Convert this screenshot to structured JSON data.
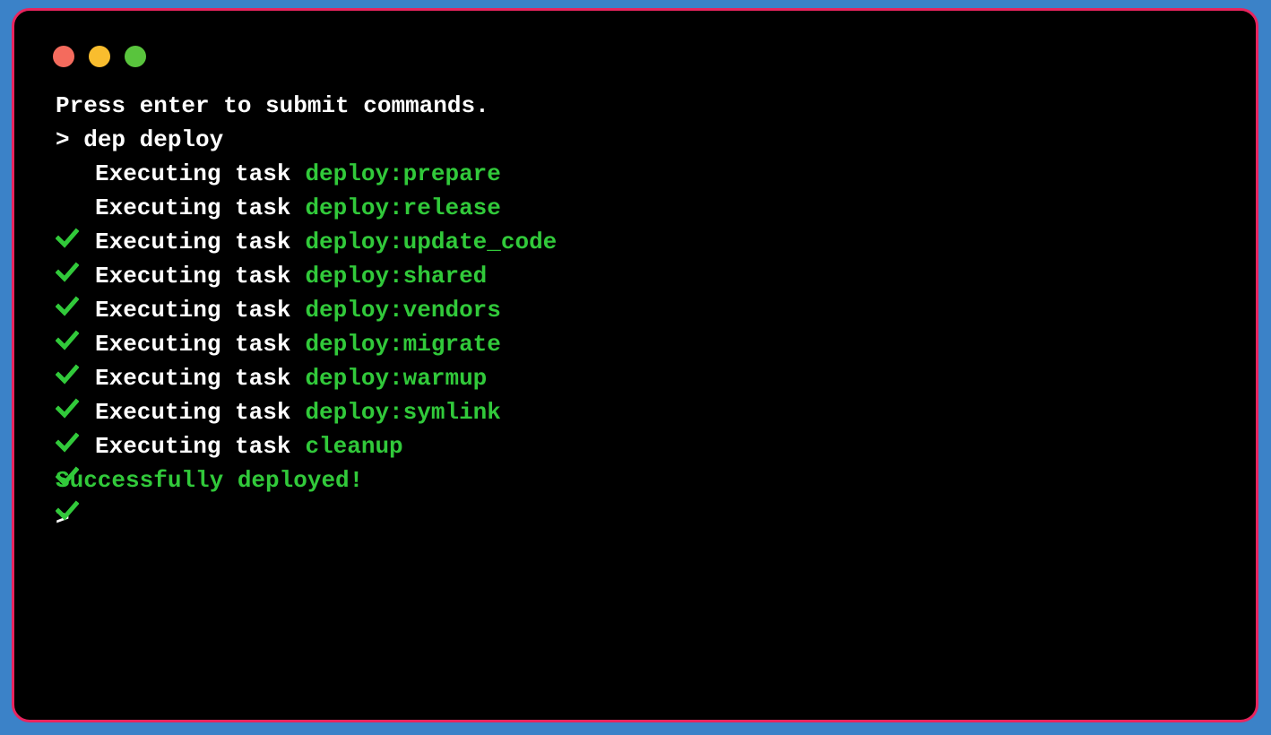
{
  "colors": {
    "background": "#3b82c8",
    "window_border": "#e8245e",
    "terminal_bg": "#000000",
    "text": "#ffffff",
    "accent_green": "#31c93a",
    "light_close": "#f46b5d",
    "light_minimize": "#f9bd2e",
    "light_maximize": "#59c43d"
  },
  "icons": {
    "close": "close-circle-icon",
    "minimize": "minimize-circle-icon",
    "maximize": "maximize-circle-icon",
    "check": "checkmark-icon"
  },
  "terminal": {
    "intro": "Press enter to submit commands.",
    "command_prompt": ">",
    "command": "dep deploy",
    "task_prefix": "Executing task",
    "tasks": [
      "deploy:prepare",
      "deploy:release",
      "deploy:update_code",
      "deploy:shared",
      "deploy:vendors",
      "deploy:migrate",
      "deploy:warmup",
      "deploy:symlink",
      "cleanup"
    ],
    "success": "Successfully deployed!",
    "input_prompt": ">"
  }
}
